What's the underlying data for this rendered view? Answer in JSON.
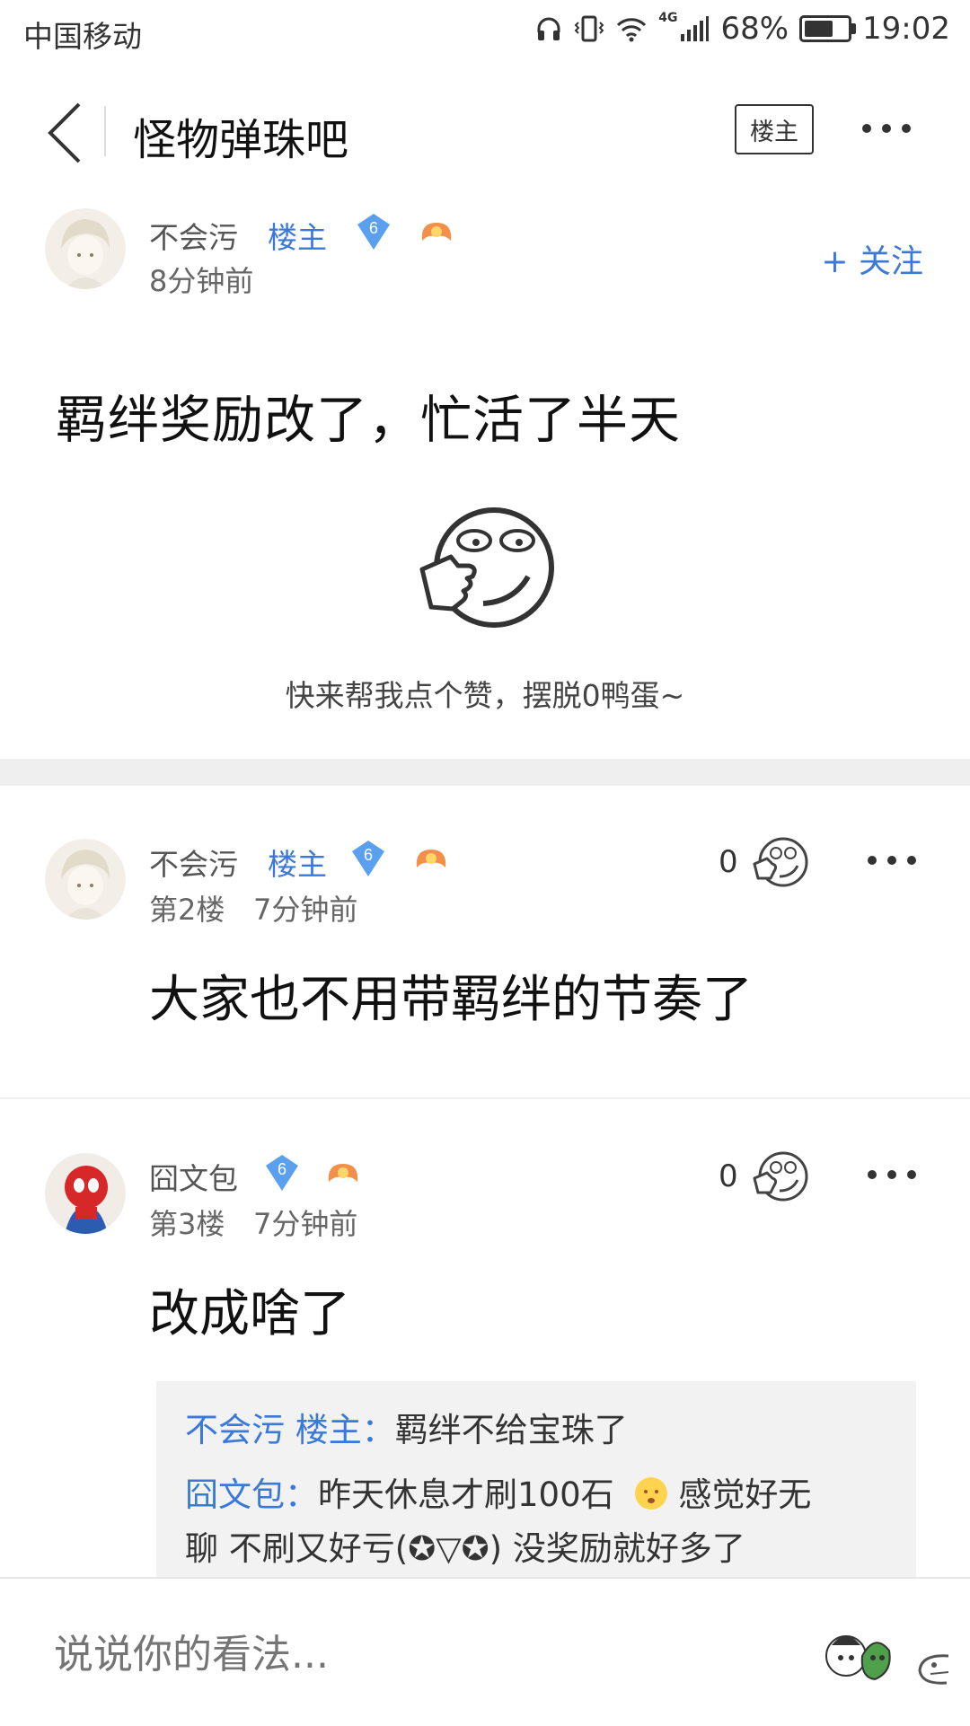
{
  "status_bar": {
    "carrier": "中国移动",
    "network": "4G",
    "battery": "68%",
    "battery_level": 0.68,
    "time": "19:02"
  },
  "header": {
    "title": "怪物弹珠吧",
    "owner_button": "楼主"
  },
  "main_post": {
    "username": "不会污",
    "owner_tag": "楼主",
    "level": "6",
    "time": "8分钟前",
    "follow_label": "+ 关注",
    "content": "羁绊奖励改了，忙活了半天",
    "caption": "快来帮我点个赞，摆脱0鸭蛋~"
  },
  "replies": [
    {
      "username": "不会污",
      "owner_tag": "楼主",
      "level": "6",
      "floor": "第2楼",
      "time": "7分钟前",
      "likes": "0",
      "content": "大家也不用带羁绊的节奏了"
    },
    {
      "username": "囧文包",
      "owner_tag": "",
      "level": "6",
      "floor": "第3楼",
      "time": "7分钟前",
      "likes": "0",
      "content": "改成啥了",
      "sub_replies": [
        {
          "name": "不会污 楼主：",
          "text": "羁绊不给宝珠了"
        },
        {
          "name": "囧文包：",
          "text": "昨天休息才刷100石",
          "text2": "感觉好无",
          "text3": "聊 不刷又好亏(✪▽✪) 没奖励就好多了"
        }
      ]
    }
  ],
  "bottom_bar": {
    "input_placeholder": "说说你的看法..."
  },
  "colors": {
    "accent": "#3a78d9",
    "badge": "#5aa0ef"
  }
}
